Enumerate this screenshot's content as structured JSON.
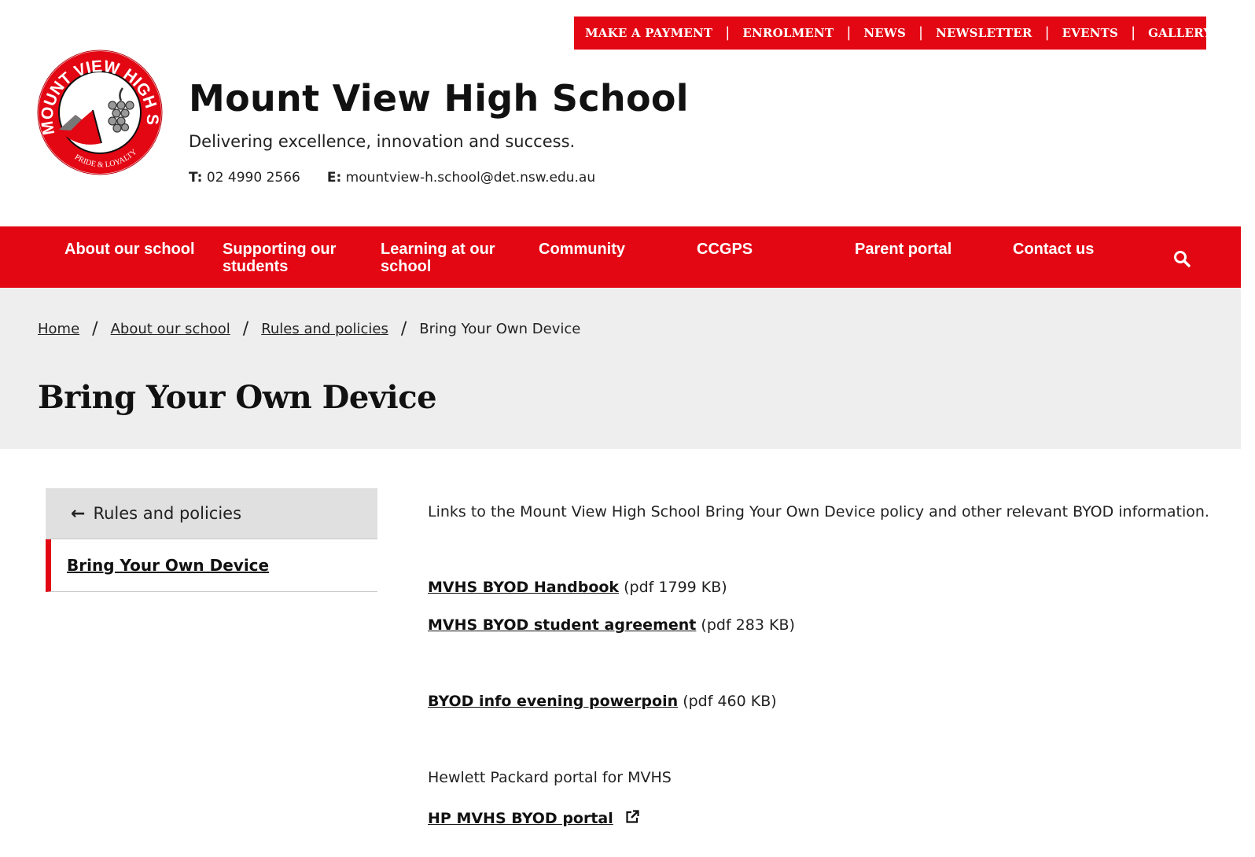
{
  "utility_nav": [
    "MAKE A PAYMENT",
    "ENROLMENT",
    "NEWS",
    "NEWSLETTER",
    "EVENTS",
    "GALLERY"
  ],
  "header": {
    "logo_alt": "Mount View High School crest",
    "logo_text_ring": "MOUNT VIEW HIGH SCHOOL",
    "logo_motto": "PRIDE & LOYALTY",
    "school_name": "Mount View High School",
    "tagline": "Delivering excellence, innovation and success.",
    "phone_label": "T:",
    "phone": "02 4990 2566",
    "email_label": "E:",
    "email": "mountview-h.school@det.nsw.edu.au"
  },
  "main_nav": [
    {
      "label_line1": "About our school",
      "label_line2": ""
    },
    {
      "label_line1": "Supporting our",
      "label_line2": "students"
    },
    {
      "label_line1": "Learning at our",
      "label_line2": "school"
    },
    {
      "label_line1": "Community",
      "label_line2": ""
    },
    {
      "label_line1": "CCGPS",
      "label_line2": ""
    },
    {
      "label_line1": "Parent portal",
      "label_line2": ""
    },
    {
      "label_line1": "Contact us",
      "label_line2": ""
    }
  ],
  "breadcrumb": [
    "Home",
    "About our school",
    "Rules and policies",
    "Bring Your Own Device"
  ],
  "page_title": "Bring Your Own Device",
  "side_nav": {
    "back_label": "Rules and policies",
    "current_label": "Bring Your Own Device"
  },
  "content": {
    "intro": "Links to the Mount View High School Bring Your Own Device policy and other relevant BYOD information.",
    "links": [
      {
        "label": "MVHS BYOD Handbook",
        "meta": "(pdf 1799 KB)"
      },
      {
        "label": "MVHS BYOD student agreement",
        "meta": "(pdf 283 KB)"
      },
      {
        "label": "BYOD info evening powerpoin",
        "meta": "(pdf 460 KB)"
      }
    ],
    "hp_text": "Hewlett Packard portal for MVHS",
    "hp_link": "HP MVHS BYOD portal"
  },
  "colors": {
    "brand_red": "#e30613",
    "hero_grey": "#eeeeee",
    "side_grey": "#e0e0e0"
  },
  "icons": {
    "search": "search-icon",
    "back": "arrow-left-icon",
    "external": "external-link-icon"
  }
}
